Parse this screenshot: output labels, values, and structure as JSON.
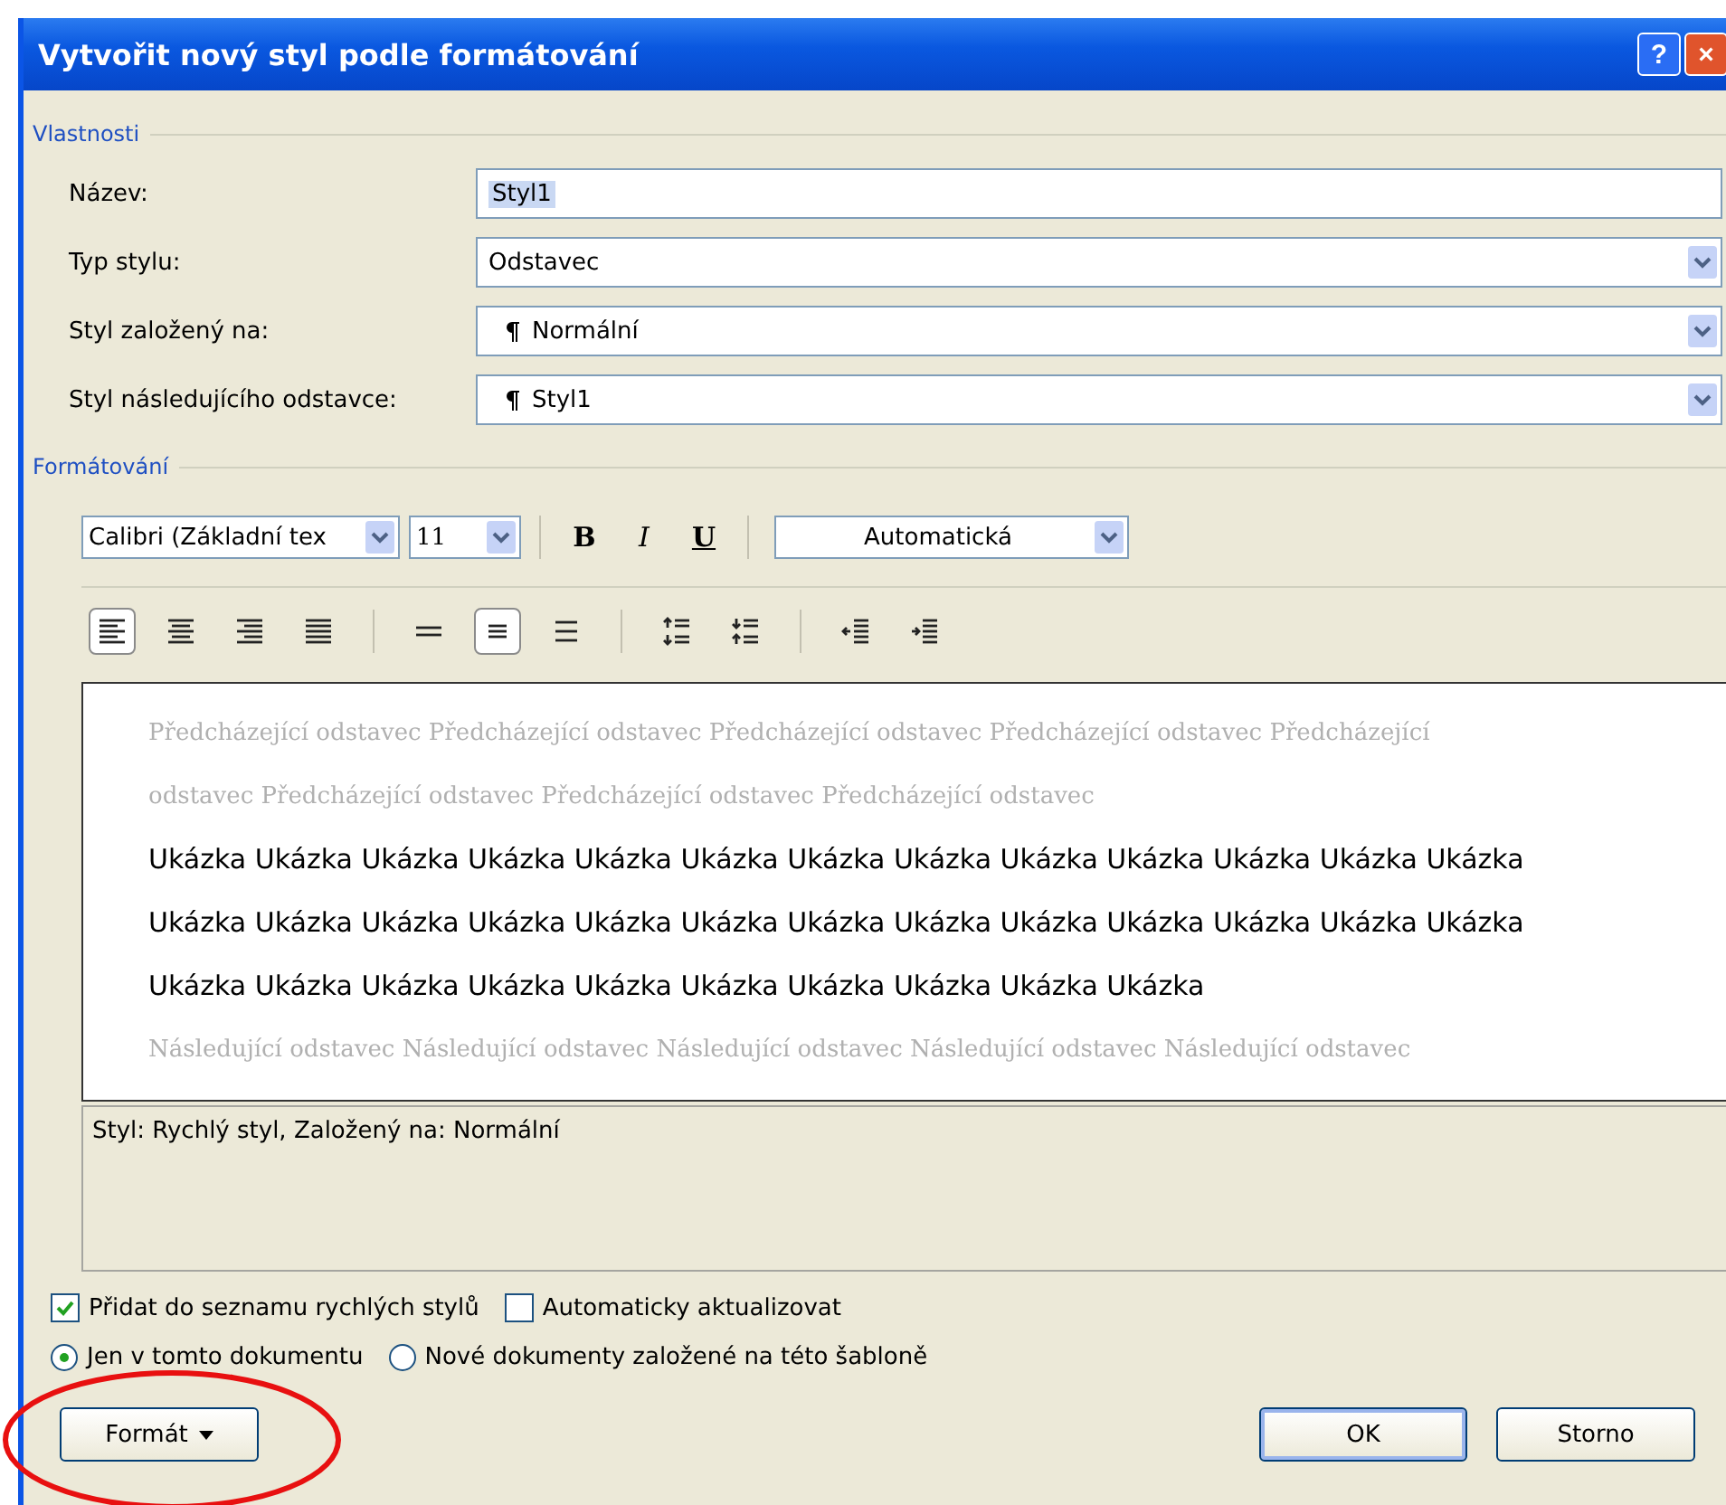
{
  "window": {
    "title": "Vytvořit nový styl podle formátování",
    "buttons": [
      "?",
      "×"
    ]
  },
  "properties": {
    "legend": "Vlastnosti",
    "fields": [
      {
        "label": "Název:",
        "value": "Styl1",
        "kind": "text"
      },
      {
        "label": "Typ stylu:",
        "value": "Odstavec",
        "kind": "select"
      },
      {
        "label": "Styl založený na:",
        "value": "Normální",
        "kind": "paragraph-select"
      },
      {
        "label": "Styl následujícího odstavce:",
        "value": "Styl1",
        "kind": "paragraph-select"
      }
    ]
  },
  "formatting": {
    "legend": "Formátování",
    "font": "Calibri (Základní tex",
    "size": "11",
    "bold": "B",
    "italic": "I",
    "underline": "U",
    "font_color": "Automatická",
    "tools": [
      {
        "kind": "align-left",
        "selected": true
      },
      {
        "kind": "align-center",
        "selected": false
      },
      {
        "kind": "align-right",
        "selected": false
      },
      {
        "kind": "justify",
        "selected": false
      },
      {
        "kind": "sep"
      },
      {
        "kind": "spacing-single",
        "selected": false
      },
      {
        "kind": "spacing-1-5",
        "selected": true
      },
      {
        "kind": "spacing-double",
        "selected": false
      },
      {
        "kind": "sep"
      },
      {
        "kind": "space-increase",
        "selected": false
      },
      {
        "kind": "space-decrease",
        "selected": false
      },
      {
        "kind": "sep"
      },
      {
        "kind": "indent-decrease",
        "selected": false
      },
      {
        "kind": "indent-increase",
        "selected": false
      }
    ]
  },
  "preview": {
    "lines": [
      {
        "kind": "before",
        "text": "Předcházející odstavec Předcházející odstavec Předcházející odstavec Předcházející odstavec Předcházející"
      },
      {
        "kind": "before",
        "text": "odstavec Předcházející odstavec Předcházející odstavec Předcházející odstavec"
      },
      {
        "kind": "sample",
        "text": "Ukázka Ukázka Ukázka Ukázka Ukázka Ukázka Ukázka Ukázka Ukázka Ukázka Ukázka Ukázka Ukázka"
      },
      {
        "kind": "sample",
        "text": "Ukázka Ukázka Ukázka Ukázka Ukázka Ukázka Ukázka Ukázka Ukázka Ukázka Ukázka Ukázka Ukázka"
      },
      {
        "kind": "sample",
        "text": "Ukázka Ukázka Ukázka Ukázka Ukázka Ukázka Ukázka Ukázka Ukázka Ukázka"
      },
      {
        "kind": "after",
        "text": "Následující odstavec Následující odstavec Následující odstavec Následující odstavec Následující odstavec"
      }
    ]
  },
  "description": "Styl: Rychlý styl, Založený na: Normální",
  "checkboxes": [
    {
      "label": "Přidat do seznamu rychlých stylů",
      "checked": true
    },
    {
      "label": "Automaticky aktualizovat",
      "checked": false
    }
  ],
  "radios": [
    {
      "label": "Jen v tomto dokumentu",
      "selected": true
    },
    {
      "label": "Nové dokumenty založené na této šabloně",
      "selected": false
    }
  ],
  "buttons": {
    "format": "Formát",
    "ok": "OK",
    "cancel": "Storno"
  },
  "annotation": {
    "kind": "ellipse"
  }
}
